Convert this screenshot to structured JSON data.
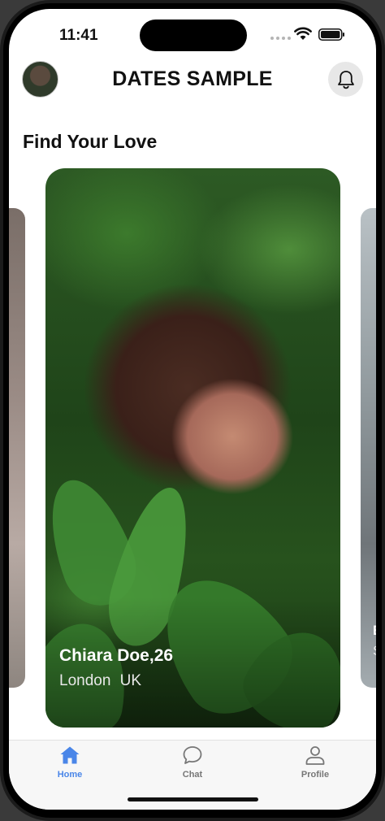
{
  "status_bar": {
    "time": "11:41"
  },
  "header": {
    "title": "DATES SAMPLE"
  },
  "section": {
    "title": "Find Your Love"
  },
  "profile_card": {
    "name": "Chiara Doe,26",
    "location": "London  UK"
  },
  "peek_card_right": {
    "line1": "E",
    "line2": "S"
  },
  "tabs": [
    {
      "label": "Home",
      "icon": "house-icon",
      "active": true
    },
    {
      "label": "Chat",
      "icon": "chat-bubble-icon",
      "active": false
    },
    {
      "label": "Profile",
      "icon": "person-icon",
      "active": false
    }
  ],
  "colors": {
    "accent": "#4a86e8",
    "inactive": "#777777"
  }
}
